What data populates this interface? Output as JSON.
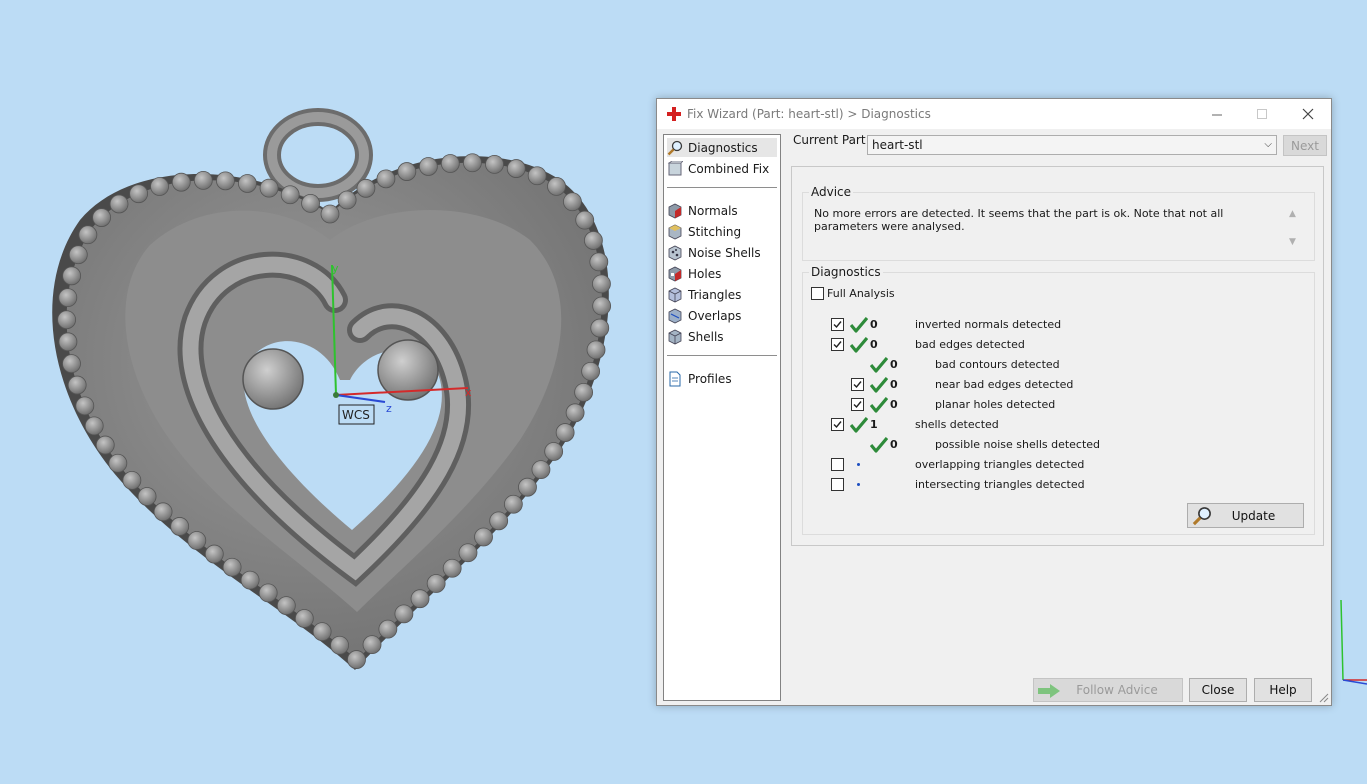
{
  "window": {
    "title": "Fix Wizard (Part: heart-stl) > Diagnostics"
  },
  "viewport": {
    "wcs_label": "WCS",
    "axis_y": "y",
    "axis_z": "z",
    "axis_x": "x"
  },
  "sidebar": {
    "items": [
      {
        "label": "Diagnostics",
        "icon": "magnifier-icon"
      },
      {
        "label": "Combined Fix",
        "icon": "combined-fix-icon"
      },
      {
        "label": "Normals",
        "icon": "normals-cube-icon"
      },
      {
        "label": "Stitching",
        "icon": "stitching-cube-icon"
      },
      {
        "label": "Noise Shells",
        "icon": "noise-shells-icon"
      },
      {
        "label": "Holes",
        "icon": "holes-cube-icon"
      },
      {
        "label": "Triangles",
        "icon": "triangles-cube-icon"
      },
      {
        "label": "Overlaps",
        "icon": "overlaps-cube-icon"
      },
      {
        "label": "Shells",
        "icon": "shells-cube-icon"
      },
      {
        "label": "Profiles",
        "icon": "profiles-doc-icon"
      }
    ]
  },
  "header": {
    "current_part_label": "Current Part:",
    "current_part_value": "heart-stl",
    "next_label": "Next"
  },
  "advice": {
    "title": "Advice",
    "text": "No more errors are detected. It seems that the part is ok. Note that not all parameters were analysed."
  },
  "diagnostics": {
    "title": "Diagnostics",
    "full_analysis_label": "Full Analysis",
    "full_analysis_checked": false,
    "rows": [
      {
        "checked": true,
        "status": "ok",
        "count": "0",
        "label": "inverted normals detected"
      },
      {
        "checked": true,
        "status": "ok",
        "count": "0",
        "label": "bad edges detected"
      },
      {
        "checked": null,
        "status": "ok",
        "count": "0",
        "label": "bad contours detected"
      },
      {
        "checked": true,
        "status": "ok",
        "count": "0",
        "label": "near bad edges detected"
      },
      {
        "checked": true,
        "status": "ok",
        "count": "0",
        "label": "planar holes detected"
      },
      {
        "checked": true,
        "status": "ok",
        "count": "1",
        "label": "shells detected"
      },
      {
        "checked": null,
        "status": "ok",
        "count": "0",
        "label": "possible noise shells detected"
      },
      {
        "checked": false,
        "status": "pending",
        "count": "",
        "label": "overlapping triangles detected"
      },
      {
        "checked": false,
        "status": "pending",
        "count": "",
        "label": "intersecting triangles detected"
      }
    ],
    "update_label": "Update"
  },
  "footer": {
    "follow_advice_label": "Follow Advice",
    "close_label": "Close",
    "help_label": "Help"
  },
  "colors": {
    "background": "#bcdcf5",
    "ok_tick": "#2e8b3a",
    "pending_dot": "#1e4fc0"
  }
}
